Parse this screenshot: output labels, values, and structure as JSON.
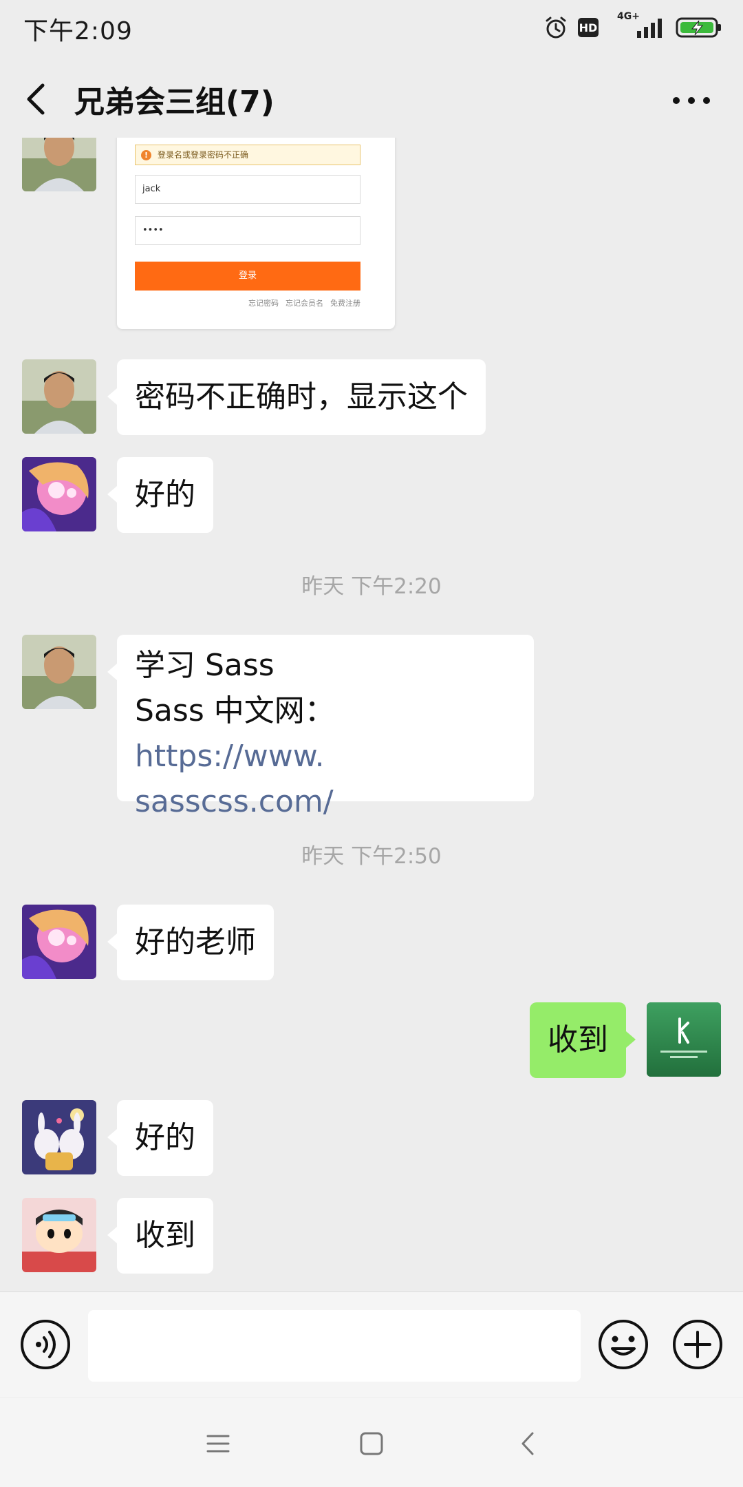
{
  "status_bar": {
    "time": "下午2:09",
    "hd_label": "HD",
    "network_label": "4G+",
    "icons": [
      "alarm-icon",
      "hd-badge",
      "signal-icon",
      "battery-charging-icon"
    ]
  },
  "header": {
    "back_icon": "chevron-left-icon",
    "title": "兄弟会三组(7)",
    "more_icon": "more-dots-icon"
  },
  "login_screenshot": {
    "error_text": "登录名或登录密码不正确",
    "username_value": "jack",
    "password_value": "••••",
    "login_button_label": "登录",
    "links": [
      "忘记密码",
      "忘记会员名",
      "免费注册"
    ],
    "button_color": "#ff6a13"
  },
  "messages": {
    "m1_text": "密码不正确时，显示这个",
    "m2_text": "好的",
    "timestamp_1": "昨天 下午2:20",
    "m3_line1": "学习 Sass",
    "m3_line2_prefix": "Sass 中文网：",
    "m3_link_part1": "https://www.",
    "m3_link_part2": "sasscss.com/",
    "timestamp_2": "昨天 下午2:50",
    "m4_text": "好的老师",
    "m5_text": "收到",
    "m6_text": "好的",
    "m7_text": "收到"
  },
  "input_bar": {
    "placeholder": "",
    "voice_icon": "voice-icon",
    "emoji_icon": "emoji-icon",
    "plus_icon": "plus-icon"
  },
  "nav_bar": {
    "icons": [
      "menu-icon",
      "home-square-icon",
      "back-triangle-icon"
    ]
  },
  "colors": {
    "background": "#ededed",
    "sent_bubble": "#95ec69",
    "received_bubble": "#ffffff",
    "link": "#576b95",
    "timestamp": "#a6a6a6"
  }
}
